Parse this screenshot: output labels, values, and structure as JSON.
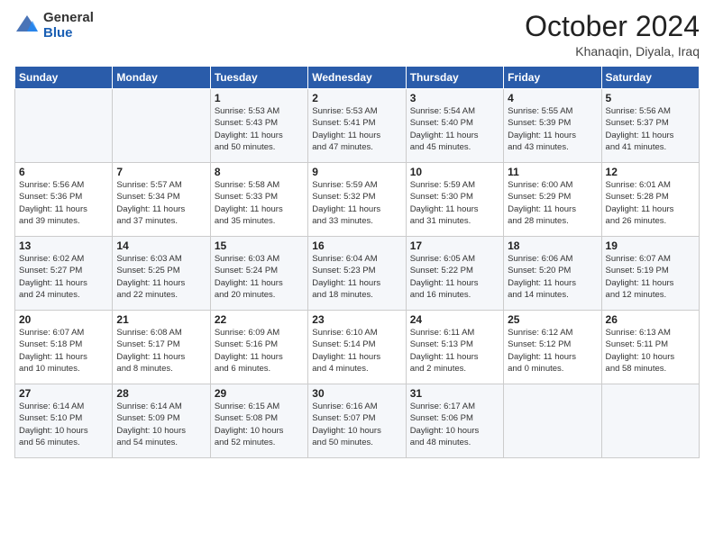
{
  "logo": {
    "general": "General",
    "blue": "Blue"
  },
  "title": "October 2024",
  "location": "Khanaqin, Diyala, Iraq",
  "days_header": [
    "Sunday",
    "Monday",
    "Tuesday",
    "Wednesday",
    "Thursday",
    "Friday",
    "Saturday"
  ],
  "weeks": [
    [
      {
        "day": "",
        "info": ""
      },
      {
        "day": "",
        "info": ""
      },
      {
        "day": "1",
        "info": "Sunrise: 5:53 AM\nSunset: 5:43 PM\nDaylight: 11 hours\nand 50 minutes."
      },
      {
        "day": "2",
        "info": "Sunrise: 5:53 AM\nSunset: 5:41 PM\nDaylight: 11 hours\nand 47 minutes."
      },
      {
        "day": "3",
        "info": "Sunrise: 5:54 AM\nSunset: 5:40 PM\nDaylight: 11 hours\nand 45 minutes."
      },
      {
        "day": "4",
        "info": "Sunrise: 5:55 AM\nSunset: 5:39 PM\nDaylight: 11 hours\nand 43 minutes."
      },
      {
        "day": "5",
        "info": "Sunrise: 5:56 AM\nSunset: 5:37 PM\nDaylight: 11 hours\nand 41 minutes."
      }
    ],
    [
      {
        "day": "6",
        "info": "Sunrise: 5:56 AM\nSunset: 5:36 PM\nDaylight: 11 hours\nand 39 minutes."
      },
      {
        "day": "7",
        "info": "Sunrise: 5:57 AM\nSunset: 5:34 PM\nDaylight: 11 hours\nand 37 minutes."
      },
      {
        "day": "8",
        "info": "Sunrise: 5:58 AM\nSunset: 5:33 PM\nDaylight: 11 hours\nand 35 minutes."
      },
      {
        "day": "9",
        "info": "Sunrise: 5:59 AM\nSunset: 5:32 PM\nDaylight: 11 hours\nand 33 minutes."
      },
      {
        "day": "10",
        "info": "Sunrise: 5:59 AM\nSunset: 5:30 PM\nDaylight: 11 hours\nand 31 minutes."
      },
      {
        "day": "11",
        "info": "Sunrise: 6:00 AM\nSunset: 5:29 PM\nDaylight: 11 hours\nand 28 minutes."
      },
      {
        "day": "12",
        "info": "Sunrise: 6:01 AM\nSunset: 5:28 PM\nDaylight: 11 hours\nand 26 minutes."
      }
    ],
    [
      {
        "day": "13",
        "info": "Sunrise: 6:02 AM\nSunset: 5:27 PM\nDaylight: 11 hours\nand 24 minutes."
      },
      {
        "day": "14",
        "info": "Sunrise: 6:03 AM\nSunset: 5:25 PM\nDaylight: 11 hours\nand 22 minutes."
      },
      {
        "day": "15",
        "info": "Sunrise: 6:03 AM\nSunset: 5:24 PM\nDaylight: 11 hours\nand 20 minutes."
      },
      {
        "day": "16",
        "info": "Sunrise: 6:04 AM\nSunset: 5:23 PM\nDaylight: 11 hours\nand 18 minutes."
      },
      {
        "day": "17",
        "info": "Sunrise: 6:05 AM\nSunset: 5:22 PM\nDaylight: 11 hours\nand 16 minutes."
      },
      {
        "day": "18",
        "info": "Sunrise: 6:06 AM\nSunset: 5:20 PM\nDaylight: 11 hours\nand 14 minutes."
      },
      {
        "day": "19",
        "info": "Sunrise: 6:07 AM\nSunset: 5:19 PM\nDaylight: 11 hours\nand 12 minutes."
      }
    ],
    [
      {
        "day": "20",
        "info": "Sunrise: 6:07 AM\nSunset: 5:18 PM\nDaylight: 11 hours\nand 10 minutes."
      },
      {
        "day": "21",
        "info": "Sunrise: 6:08 AM\nSunset: 5:17 PM\nDaylight: 11 hours\nand 8 minutes."
      },
      {
        "day": "22",
        "info": "Sunrise: 6:09 AM\nSunset: 5:16 PM\nDaylight: 11 hours\nand 6 minutes."
      },
      {
        "day": "23",
        "info": "Sunrise: 6:10 AM\nSunset: 5:14 PM\nDaylight: 11 hours\nand 4 minutes."
      },
      {
        "day": "24",
        "info": "Sunrise: 6:11 AM\nSunset: 5:13 PM\nDaylight: 11 hours\nand 2 minutes."
      },
      {
        "day": "25",
        "info": "Sunrise: 6:12 AM\nSunset: 5:12 PM\nDaylight: 11 hours\nand 0 minutes."
      },
      {
        "day": "26",
        "info": "Sunrise: 6:13 AM\nSunset: 5:11 PM\nDaylight: 10 hours\nand 58 minutes."
      }
    ],
    [
      {
        "day": "27",
        "info": "Sunrise: 6:14 AM\nSunset: 5:10 PM\nDaylight: 10 hours\nand 56 minutes."
      },
      {
        "day": "28",
        "info": "Sunrise: 6:14 AM\nSunset: 5:09 PM\nDaylight: 10 hours\nand 54 minutes."
      },
      {
        "day": "29",
        "info": "Sunrise: 6:15 AM\nSunset: 5:08 PM\nDaylight: 10 hours\nand 52 minutes."
      },
      {
        "day": "30",
        "info": "Sunrise: 6:16 AM\nSunset: 5:07 PM\nDaylight: 10 hours\nand 50 minutes."
      },
      {
        "day": "31",
        "info": "Sunrise: 6:17 AM\nSunset: 5:06 PM\nDaylight: 10 hours\nand 48 minutes."
      },
      {
        "day": "",
        "info": ""
      },
      {
        "day": "",
        "info": ""
      }
    ]
  ]
}
